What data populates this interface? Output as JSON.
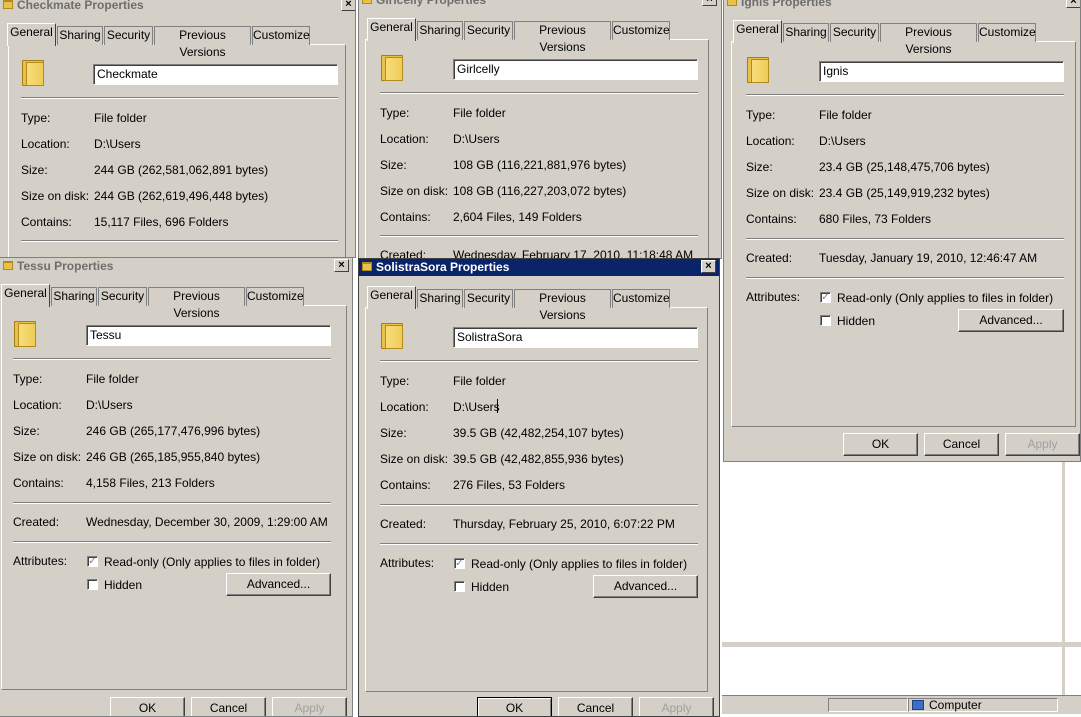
{
  "windows": {
    "checkmate": {
      "title": "Checkmate Properties",
      "tabs": [
        "General",
        "Sharing",
        "Security",
        "Previous Versions",
        "Customize"
      ],
      "name": "Checkmate",
      "type_label": "Type:",
      "type": "File folder",
      "location_label": "Location:",
      "location": "D:\\Users",
      "size_label": "Size:",
      "size": "244 GB (262,581,062,891 bytes)",
      "sod_label": "Size on disk:",
      "size_on_disk": "244 GB (262,619,496,448 bytes)",
      "contains_label": "Contains:",
      "contains": "15,117 Files, 696 Folders"
    },
    "girlcelly": {
      "title": "Girlcelly Properties",
      "tabs": [
        "General",
        "Sharing",
        "Security",
        "Previous Versions",
        "Customize"
      ],
      "name": "Girlcelly",
      "type_label": "Type:",
      "type": "File folder",
      "location_label": "Location:",
      "location": "D:\\Users",
      "size_label": "Size:",
      "size": "108 GB (116,221,881,976 bytes)",
      "sod_label": "Size on disk:",
      "size_on_disk": "108 GB (116,227,203,072 bytes)",
      "contains_label": "Contains:",
      "contains": "2,604 Files, 149 Folders",
      "created_label": "Created:",
      "created": "Wednesday, February 17, 2010, 11:18:48 AM"
    },
    "ignis": {
      "title": "Ignis Properties",
      "tabs": [
        "General",
        "Sharing",
        "Security",
        "Previous Versions",
        "Customize"
      ],
      "name": "Ignis",
      "type_label": "Type:",
      "type": "File folder",
      "location_label": "Location:",
      "location": "D:\\Users",
      "size_label": "Size:",
      "size": "23.4 GB (25,148,475,706 bytes)",
      "sod_label": "Size on disk:",
      "size_on_disk": "23.4 GB (25,149,919,232 bytes)",
      "contains_label": "Contains:",
      "contains": "680 Files, 73 Folders",
      "created_label": "Created:",
      "created": "Tuesday, January 19, 2010, 12:46:47 AM",
      "attributes_label": "Attributes:",
      "readonly_label": "Read-only (Only applies to files in folder)",
      "hidden_label": "Hidden",
      "advanced_label": "Advanced...",
      "ok": "OK",
      "cancel": "Cancel",
      "apply": "Apply"
    },
    "tessu": {
      "title": "Tessu Properties",
      "tabs": [
        "General",
        "Sharing",
        "Security",
        "Previous Versions",
        "Customize"
      ],
      "name": "Tessu",
      "type_label": "Type:",
      "type": "File folder",
      "location_label": "Location:",
      "location": "D:\\Users",
      "size_label": "Size:",
      "size": "246 GB (265,177,476,996 bytes)",
      "sod_label": "Size on disk:",
      "size_on_disk": "246 GB (265,185,955,840 bytes)",
      "contains_label": "Contains:",
      "contains": "4,158 Files, 213 Folders",
      "created_label": "Created:",
      "created": "Wednesday, December 30, 2009, 1:29:00 AM",
      "attributes_label": "Attributes:",
      "readonly_label": "Read-only (Only applies to files in folder)",
      "hidden_label": "Hidden",
      "advanced_label": "Advanced...",
      "ok": "OK",
      "cancel": "Cancel",
      "apply": "Apply"
    },
    "solistra": {
      "title": "SolistraSora Properties",
      "tabs": [
        "General",
        "Sharing",
        "Security",
        "Previous Versions",
        "Customize"
      ],
      "name": "SolistraSora",
      "type_label": "Type:",
      "type": "File folder",
      "location_label": "Location:",
      "location": "D:\\Users",
      "size_label": "Size:",
      "size": "39.5 GB (42,482,254,107 bytes)",
      "sod_label": "Size on disk:",
      "size_on_disk": "39.5 GB (42,482,855,936 bytes)",
      "contains_label": "Contains:",
      "contains": "276 Files, 53 Folders",
      "created_label": "Created:",
      "created": "Thursday, February 25, 2010, 6:07:22 PM",
      "attributes_label": "Attributes:",
      "readonly_label": "Read-only (Only applies to files in folder)",
      "hidden_label": "Hidden",
      "advanced_label": "Advanced...",
      "ok": "OK",
      "cancel": "Cancel",
      "apply": "Apply"
    }
  },
  "statusbar": {
    "computer_label": "Computer"
  },
  "icons": {
    "folder": "folder-icon",
    "close": "close-icon",
    "checkmark": "checkmark-icon",
    "computer": "computer-icon"
  }
}
